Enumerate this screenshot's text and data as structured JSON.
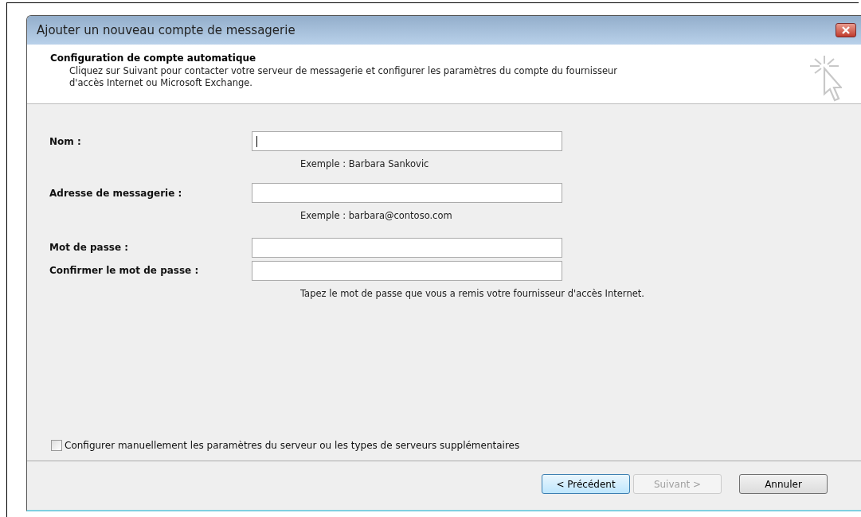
{
  "window": {
    "title": "Ajouter un nouveau compte de messagerie"
  },
  "header": {
    "title": "Configuration de compte automatique",
    "description": "Cliquez sur Suivant pour contacter votre serveur de messagerie et configurer les paramètres du compte du fournisseur d'accès Internet ou Microsoft Exchange."
  },
  "fields": [
    {
      "label": "Nom :",
      "focused": true,
      "note": "Exemple : Barbara Sankovic"
    },
    {
      "label": "Adresse de messagerie :",
      "focused": false,
      "note": "Exemple : barbara@contoso.com"
    },
    {
      "label": "Mot de passe :",
      "focused": false
    },
    {
      "label": "Confirmer le mot de passe :",
      "focused": false,
      "note": "Tapez le mot de passe que vous a remis votre fournisseur d'accès Internet."
    }
  ],
  "manual_config": {
    "label": "Configurer manuellement les paramètres du serveur ou les types de serveurs supplémentaires",
    "checked": false
  },
  "buttons": [
    {
      "label": "< Précédent",
      "default": true,
      "disabled": false
    },
    {
      "label": "Suivant >",
      "default": false,
      "disabled": true
    },
    {
      "label": "Annuler",
      "default": false,
      "disabled": false
    }
  ]
}
